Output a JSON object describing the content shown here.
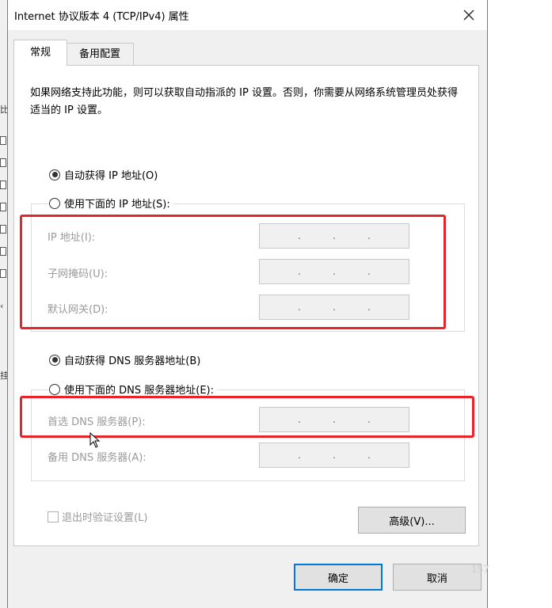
{
  "window": {
    "title": "Internet 协议版本 4 (TCP/IPv4) 属性"
  },
  "tabs": [
    {
      "label": "常规",
      "active": true
    },
    {
      "label": "备用配置",
      "active": false
    }
  ],
  "description": "如果网络支持此功能，则可以获取自动指派的 IP 设置。否则，你需要从网络系统管理员处获得适当的 IP 设置。",
  "ip_section": {
    "auto_label": "自动获得 IP 地址(O)",
    "auto_selected": true,
    "manual_label": "使用下面的 IP 地址(S):",
    "manual_selected": false,
    "fields": [
      {
        "label": "IP 地址(I):",
        "value": ".   .   ."
      },
      {
        "label": "子网掩码(U):",
        "value": ".   .   ."
      },
      {
        "label": "默认网关(D):",
        "value": ".   .   ."
      }
    ]
  },
  "dns_section": {
    "auto_label": "自动获得 DNS 服务器地址(B)",
    "auto_selected": true,
    "manual_label": "使用下面的 DNS 服务器地址(E):",
    "manual_selected": false,
    "fields": [
      {
        "label": "首选 DNS 服务器(P):",
        "value": ".   .   ."
      },
      {
        "label": "备用 DNS 服务器(A):",
        "value": ".   .   ."
      }
    ]
  },
  "validate_checkbox": {
    "label": "退出时验证设置(L)",
    "checked": false
  },
  "buttons": {
    "advanced": "高级(V)...",
    "ok": "确定",
    "cancel": "取消"
  },
  "background": {
    "left_texts": [
      "比",
      "挂"
    ],
    "watermark": "157"
  },
  "colors": {
    "highlight_box": "#e8232a",
    "default_button_border": "#0078d7",
    "disabled_text": "#9a9a9a"
  }
}
